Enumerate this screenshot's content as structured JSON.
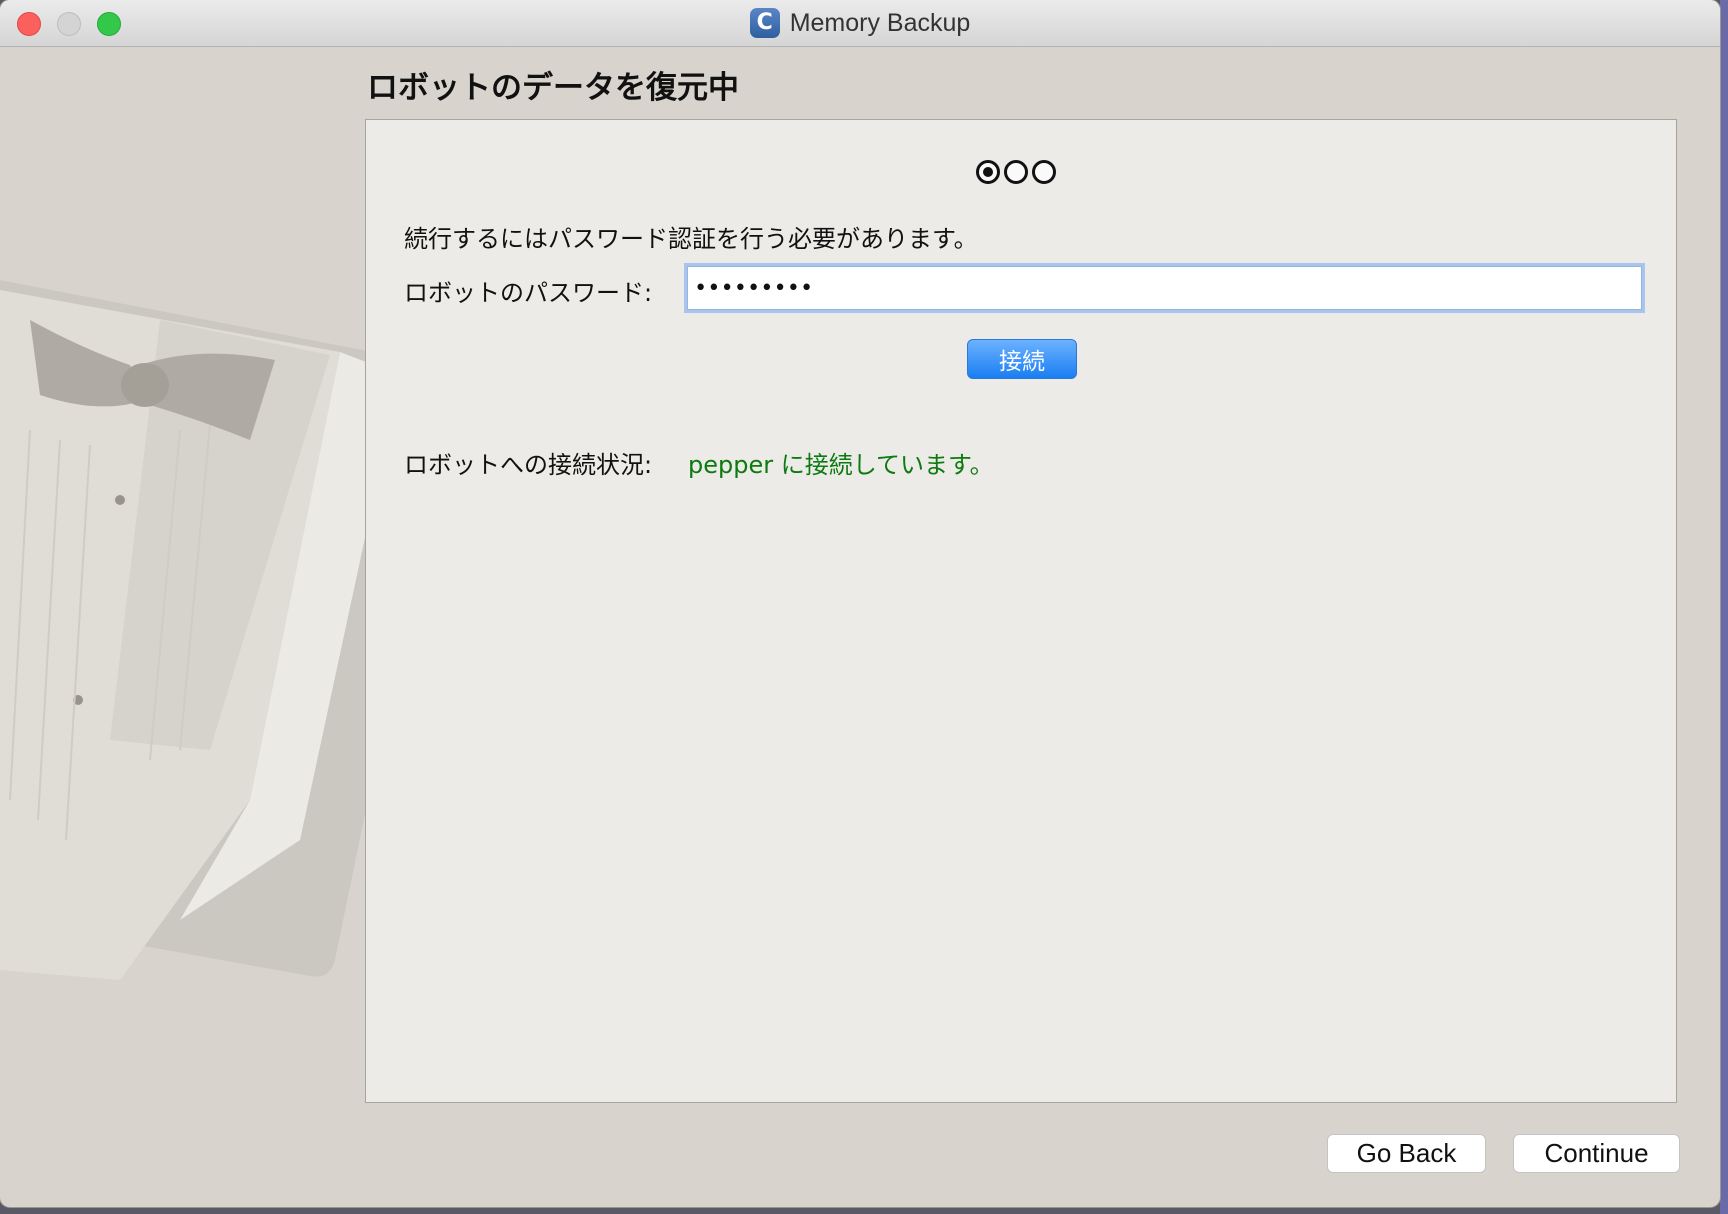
{
  "window": {
    "title": "Memory Backup",
    "app_icon_letter": "C",
    "controls": [
      "close",
      "minimize",
      "zoom"
    ]
  },
  "page": {
    "heading": "ロボットのデータを復元中"
  },
  "steps": {
    "total": 3,
    "current": 1
  },
  "auth": {
    "instruction": "続行するにはパスワード認証を行う必要があります。",
    "password_label": "ロボットのパスワード:",
    "password_value": "•••••••••",
    "connect_button": "接続"
  },
  "connection": {
    "label": "ロボットへの接続状況:",
    "status": "pepper に接続しています。",
    "status_color": "#0c7a10"
  },
  "footer": {
    "back_button": "Go Back",
    "continue_button": "Continue"
  },
  "colors": {
    "accent": "#1a7ef2",
    "window_bg": "#d8d4cd",
    "panel_bg": "#edebe7"
  }
}
